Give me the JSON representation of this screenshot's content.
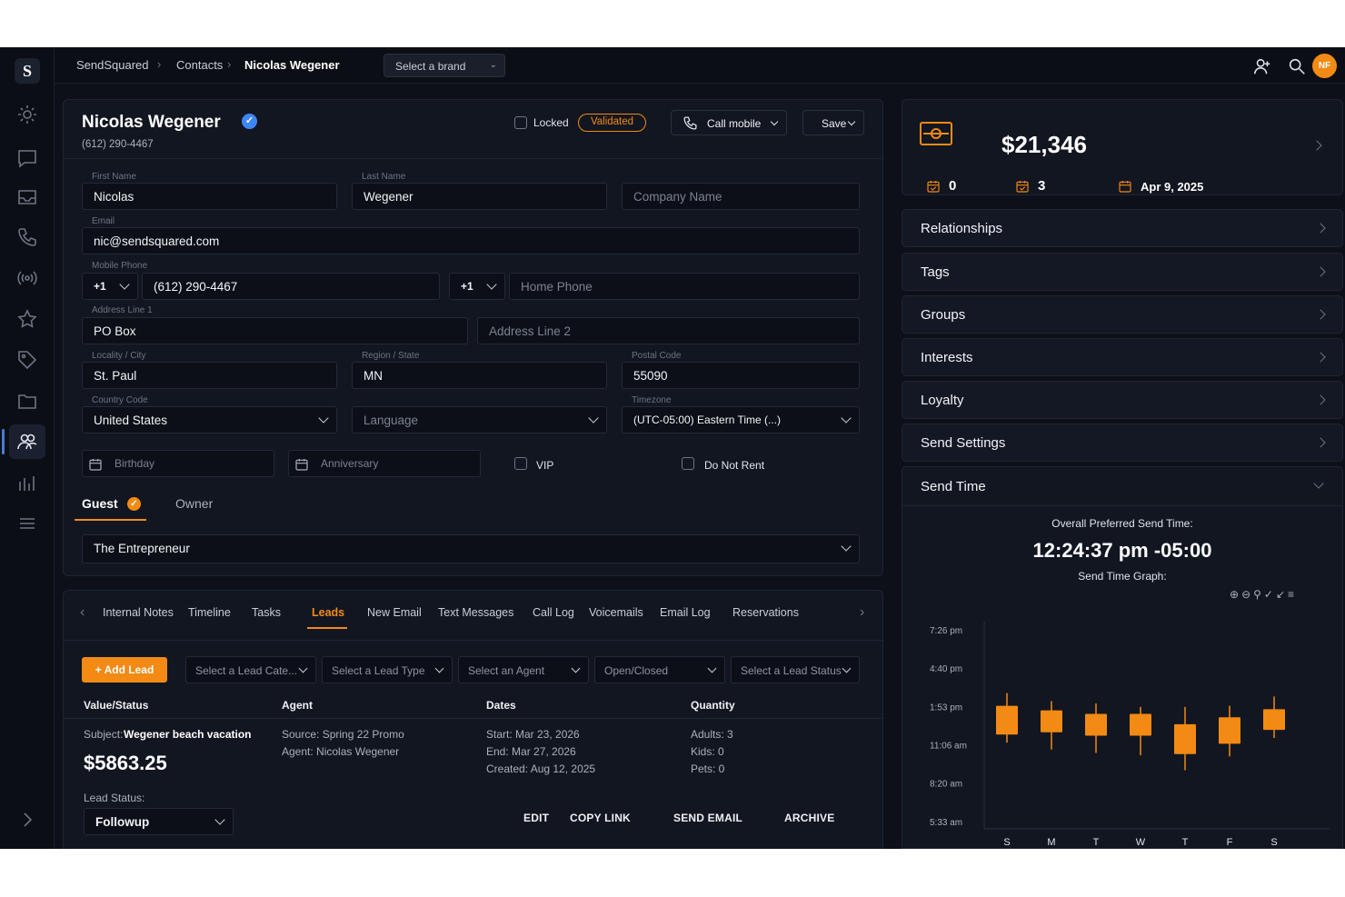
{
  "breadcrumb": {
    "root": "SendSquared",
    "section": "Contacts",
    "current": "Nicolas Wegener"
  },
  "brand_select": {
    "value": "Select a brand"
  },
  "user": {
    "initials": "NF"
  },
  "contact": {
    "name": "Nicolas Wegener",
    "phone_display": "(612) 290-4467",
    "locked_label": "Locked",
    "validated_label": "Validated",
    "call_label": "Call mobile",
    "save_label": "Save"
  },
  "form": {
    "first_name": {
      "label": "First Name",
      "value": "Nicolas"
    },
    "last_name": {
      "label": "Last Name",
      "value": "Wegener"
    },
    "company": {
      "placeholder": "Company Name"
    },
    "email": {
      "label": "Email",
      "value": "nic@sendsquared.com"
    },
    "mobile": {
      "label": "Mobile Phone",
      "code": "+1",
      "value": "(612) 290-4467"
    },
    "home": {
      "code": "+1",
      "placeholder": "Home Phone"
    },
    "address1": {
      "label": "Address Line 1",
      "value": "PO Box"
    },
    "address2": {
      "placeholder": "Address Line 2"
    },
    "city": {
      "label": "Locality / City",
      "value": "St. Paul"
    },
    "region": {
      "label": "Region / State",
      "value": "MN"
    },
    "postal": {
      "label": "Postal Code",
      "value": "55090"
    },
    "country": {
      "label": "Country Code",
      "value": "United States"
    },
    "language": {
      "placeholder": "Language"
    },
    "timezone": {
      "label": "Timezone",
      "value": "(UTC-05:00) Eastern Time (...)"
    },
    "birthday": {
      "placeholder": "Birthday"
    },
    "anniversary": {
      "placeholder": "Anniversary"
    },
    "vip_label": "VIP",
    "dnr_label": "Do Not Rent",
    "role_tabs": {
      "guest": "Guest",
      "owner": "Owner"
    },
    "persona": "The Entrepreneur"
  },
  "tabs": [
    "Internal Notes",
    "Timeline",
    "Tasks",
    "Leads",
    "New Email",
    "Text Messages",
    "Call Log",
    "Voicemails",
    "Email Log",
    "Reservations"
  ],
  "leads": {
    "add_label": "+ Add Lead",
    "filters": [
      "Select a Lead Cate...",
      "Select a Lead Type",
      "Select an Agent",
      "Open/Closed",
      "Select a Lead Status"
    ],
    "columns": [
      "Value/Status",
      "Agent",
      "Dates",
      "Quantity"
    ],
    "row": {
      "subject_label": "Subject:",
      "subject": "Wegener beach vacation",
      "amount": "$5863.25",
      "status_label": "Lead Status:",
      "status": "Followup",
      "source": "Source: Spring 22 Promo",
      "agent": "Agent: Nicolas Wegener",
      "start": "Start: Mar 23, 2026",
      "end": "End: Mar 27, 2026",
      "created": "Created: Aug 12, 2025",
      "adults": "Adults: 3",
      "kids": "Kids: 0",
      "pets": "Pets: 0"
    },
    "actions": [
      "EDIT",
      "COPY LINK",
      "SEND EMAIL",
      "ARCHIVE"
    ]
  },
  "summary": {
    "total": "$21,346",
    "stat1": "0",
    "stat2": "3",
    "date": "Apr 9, 2025"
  },
  "panels": [
    "Relationships",
    "Tags",
    "Groups",
    "Interests",
    "Loyalty",
    "Send Settings",
    "Send Time"
  ],
  "send_time": {
    "title": "Overall Preferred Send Time:",
    "value": "12:24:37 pm -05:00",
    "graph_label": "Send Time Graph:"
  },
  "accent_color": "#f28a14",
  "chart_data": {
    "type": "candlestick",
    "categories": [
      "S",
      "M",
      "T",
      "W",
      "T",
      "F",
      "S"
    ],
    "y_ticks": [
      "7:26 pm",
      "4:40 pm",
      "1:53 pm",
      "11:06 am",
      "8:20 am",
      "5:33 am"
    ],
    "y_tick_minutes": [
      1166,
      1000,
      833,
      666,
      500,
      333
    ],
    "ylim_minutes": [
      333,
      1166
    ],
    "series": [
      {
        "values": [
          {
            "low": 680,
            "open": 715,
            "close": 840,
            "high": 895
          },
          {
            "low": 650,
            "open": 725,
            "close": 820,
            "high": 860
          },
          {
            "low": 635,
            "open": 710,
            "close": 805,
            "high": 850
          },
          {
            "low": 625,
            "open": 710,
            "close": 805,
            "high": 835
          },
          {
            "low": 560,
            "open": 630,
            "close": 760,
            "high": 835
          },
          {
            "low": 620,
            "open": 675,
            "close": 790,
            "high": 840
          },
          {
            "low": 700,
            "open": 735,
            "close": 825,
            "high": 880
          }
        ]
      }
    ]
  }
}
